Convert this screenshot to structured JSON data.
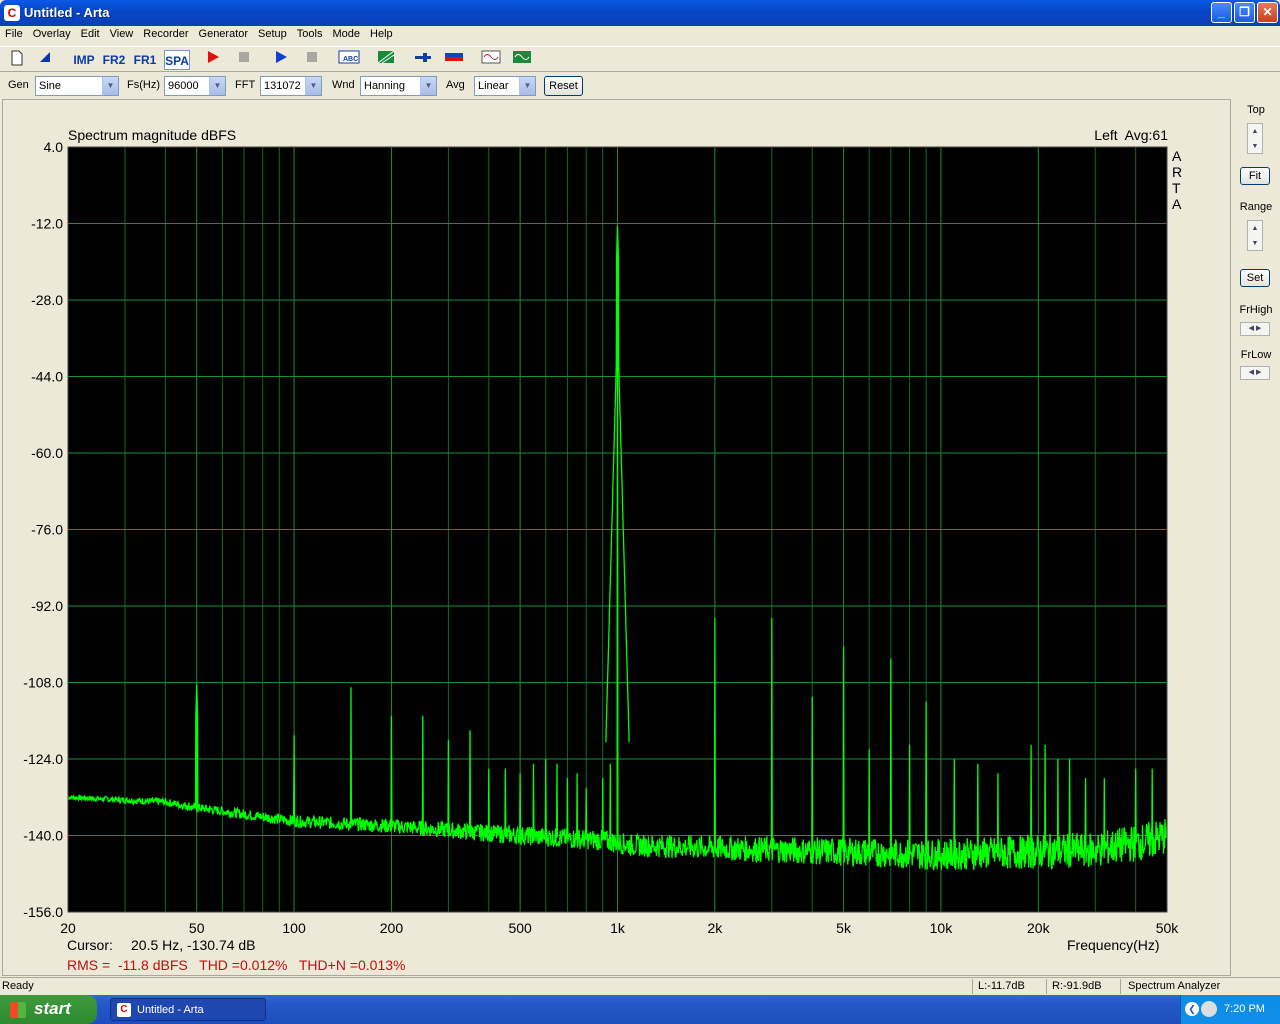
{
  "window": {
    "title": "Untitled - Arta",
    "app_icon": "arta-icon"
  },
  "menu": [
    "File",
    "Overlay",
    "Edit",
    "View",
    "Recorder",
    "Generator",
    "Setup",
    "Tools",
    "Mode",
    "Help"
  ],
  "toolbar": {
    "imp": "IMP",
    "fr2": "FR2",
    "fr1": "FR1",
    "spa": "SPA"
  },
  "controls": {
    "gen_label": "Gen",
    "gen_value": "Sine",
    "fs_label": "Fs(Hz)",
    "fs_value": "96000",
    "fft_label": "FFT",
    "fft_value": "131072",
    "wnd_label": "Wnd",
    "wnd_value": "Hanning",
    "avg_label": "Avg",
    "avg_value": "Linear",
    "reset": "Reset"
  },
  "right_panel": {
    "top": "Top",
    "fit": "Fit",
    "range": "Range",
    "set": "Set",
    "frhigh": "FrHigh",
    "frlow": "FrLow"
  },
  "plot": {
    "title": "Spectrum magnitude dBFS",
    "channel": "Left  Avg:61",
    "watermark": "ARTA",
    "cursor_label": "Cursor:",
    "cursor_value": "20.5 Hz, -130.74 dB",
    "xlabel": "Frequency(Hz)",
    "measure": "RMS =  -11.8 dBFS   THD =0.012%   THD+N =0.013%"
  },
  "chart_data": {
    "type": "line",
    "title": "Spectrum magnitude dBFS",
    "xlabel": "Frequency(Hz)",
    "ylabel": "",
    "xscale": "log",
    "xlim": [
      20,
      50000
    ],
    "ylim": [
      -156,
      4
    ],
    "grid": true,
    "x_ticks": [
      {
        "v": 20,
        "t": "20"
      },
      {
        "v": 50,
        "t": "50"
      },
      {
        "v": 100,
        "t": "100"
      },
      {
        "v": 200,
        "t": "200"
      },
      {
        "v": 500,
        "t": "500"
      },
      {
        "v": 1000,
        "t": "1k"
      },
      {
        "v": 2000,
        "t": "2k"
      },
      {
        "v": 5000,
        "t": "5k"
      },
      {
        "v": 10000,
        "t": "10k"
      },
      {
        "v": 20000,
        "t": "20k"
      },
      {
        "v": 50000,
        "t": "50k"
      }
    ],
    "y_ticks": [
      {
        "v": 4,
        "t": "4.0"
      },
      {
        "v": -12,
        "t": "-12.0"
      },
      {
        "v": -28,
        "t": "-28.0"
      },
      {
        "v": -44,
        "t": "-44.0"
      },
      {
        "v": -60,
        "t": "-60.0"
      },
      {
        "v": -76,
        "t": "-76.0"
      },
      {
        "v": -92,
        "t": "-92.0"
      },
      {
        "v": -108,
        "t": "-108.0"
      },
      {
        "v": -124,
        "t": "-124.0"
      },
      {
        "v": -140,
        "t": "-140.0"
      },
      {
        "v": -156,
        "t": "-156.0"
      }
    ],
    "noise_floor": [
      [
        20,
        -132
      ],
      [
        40,
        -133
      ],
      [
        48,
        -134
      ],
      [
        100,
        -137
      ],
      [
        200,
        -138
      ],
      [
        500,
        -140
      ],
      [
        900,
        -141
      ],
      [
        1100,
        -142
      ],
      [
        3000,
        -143
      ],
      [
        10000,
        -144
      ],
      [
        30000,
        -143
      ],
      [
        45000,
        -141
      ],
      [
        50000,
        -140
      ]
    ],
    "peaks": [
      [
        50,
        -108.5
      ],
      [
        100,
        -119
      ],
      [
        150,
        -109
      ],
      [
        200,
        -115
      ],
      [
        250,
        -115
      ],
      [
        300,
        -120
      ],
      [
        350,
        -118
      ],
      [
        400,
        -126
      ],
      [
        450,
        -126
      ],
      [
        500,
        -127
      ],
      [
        550,
        -125
      ],
      [
        600,
        -124
      ],
      [
        650,
        -125
      ],
      [
        700,
        -128
      ],
      [
        750,
        -127
      ],
      [
        800,
        -130
      ],
      [
        900,
        -128
      ],
      [
        950,
        -125
      ],
      [
        1000,
        -12.5
      ],
      [
        2000,
        -94.5
      ],
      [
        3000,
        -94.5
      ],
      [
        4000,
        -111
      ],
      [
        5000,
        -100.5
      ],
      [
        6000,
        -122
      ],
      [
        7000,
        -103
      ],
      [
        8000,
        -121
      ],
      [
        9000,
        -112
      ],
      [
        11000,
        -124
      ],
      [
        13000,
        -125
      ],
      [
        15000,
        -127
      ],
      [
        19000,
        -121
      ],
      [
        21000,
        -121
      ],
      [
        23000,
        -124
      ],
      [
        25000,
        -124
      ],
      [
        28000,
        -128
      ],
      [
        32000,
        -128
      ],
      [
        40000,
        -126
      ],
      [
        45000,
        -126
      ]
    ],
    "series_color": "#00ff00",
    "bg_color": "#000000",
    "grid_color": "#0d6b2a"
  },
  "status": {
    "ready": "Ready",
    "l": "L:-11.7dB",
    "r": "R:-91.9dB",
    "mode": "Spectrum Analyzer"
  },
  "taskbar": {
    "start": "start",
    "item": "Untitled - Arta",
    "time": "7:20 PM"
  }
}
